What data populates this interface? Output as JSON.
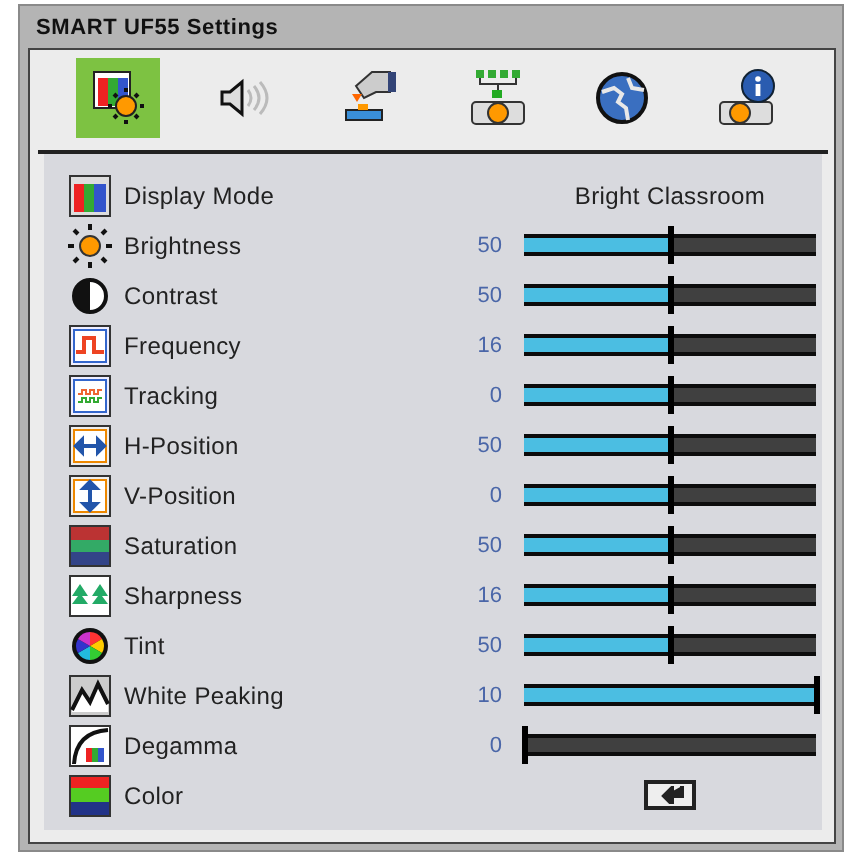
{
  "window": {
    "title": "SMART UF55 Settings"
  },
  "tabs": [
    {
      "selected": true
    },
    {
      "selected": false
    },
    {
      "selected": false
    },
    {
      "selected": false
    },
    {
      "selected": false
    },
    {
      "selected": false
    }
  ],
  "settings": [
    {
      "kind": "option",
      "label": "Display Mode",
      "value": "Bright Classroom"
    },
    {
      "kind": "slider",
      "label": "Brightness",
      "reading": "50",
      "level": 0.5
    },
    {
      "kind": "slider",
      "label": "Contrast",
      "reading": "50",
      "level": 0.5
    },
    {
      "kind": "slider",
      "label": "Frequency",
      "reading": "16",
      "level": 0.5
    },
    {
      "kind": "slider",
      "label": "Tracking",
      "reading": "0",
      "level": 0.5
    },
    {
      "kind": "slider",
      "label": "H-Position",
      "reading": "50",
      "level": 0.5
    },
    {
      "kind": "slider",
      "label": "V-Position",
      "reading": "0",
      "level": 0.5
    },
    {
      "kind": "slider",
      "label": "Saturation",
      "reading": "50",
      "level": 0.5
    },
    {
      "kind": "slider",
      "label": "Sharpness",
      "reading": "16",
      "level": 0.5
    },
    {
      "kind": "slider",
      "label": "Tint",
      "reading": "50",
      "level": 0.5
    },
    {
      "kind": "slider",
      "label": "White Peaking",
      "reading": "10",
      "level": 1
    },
    {
      "kind": "slider",
      "label": "Degamma",
      "reading": "0",
      "level": 0
    },
    {
      "kind": "enter",
      "label": "Color"
    }
  ]
}
